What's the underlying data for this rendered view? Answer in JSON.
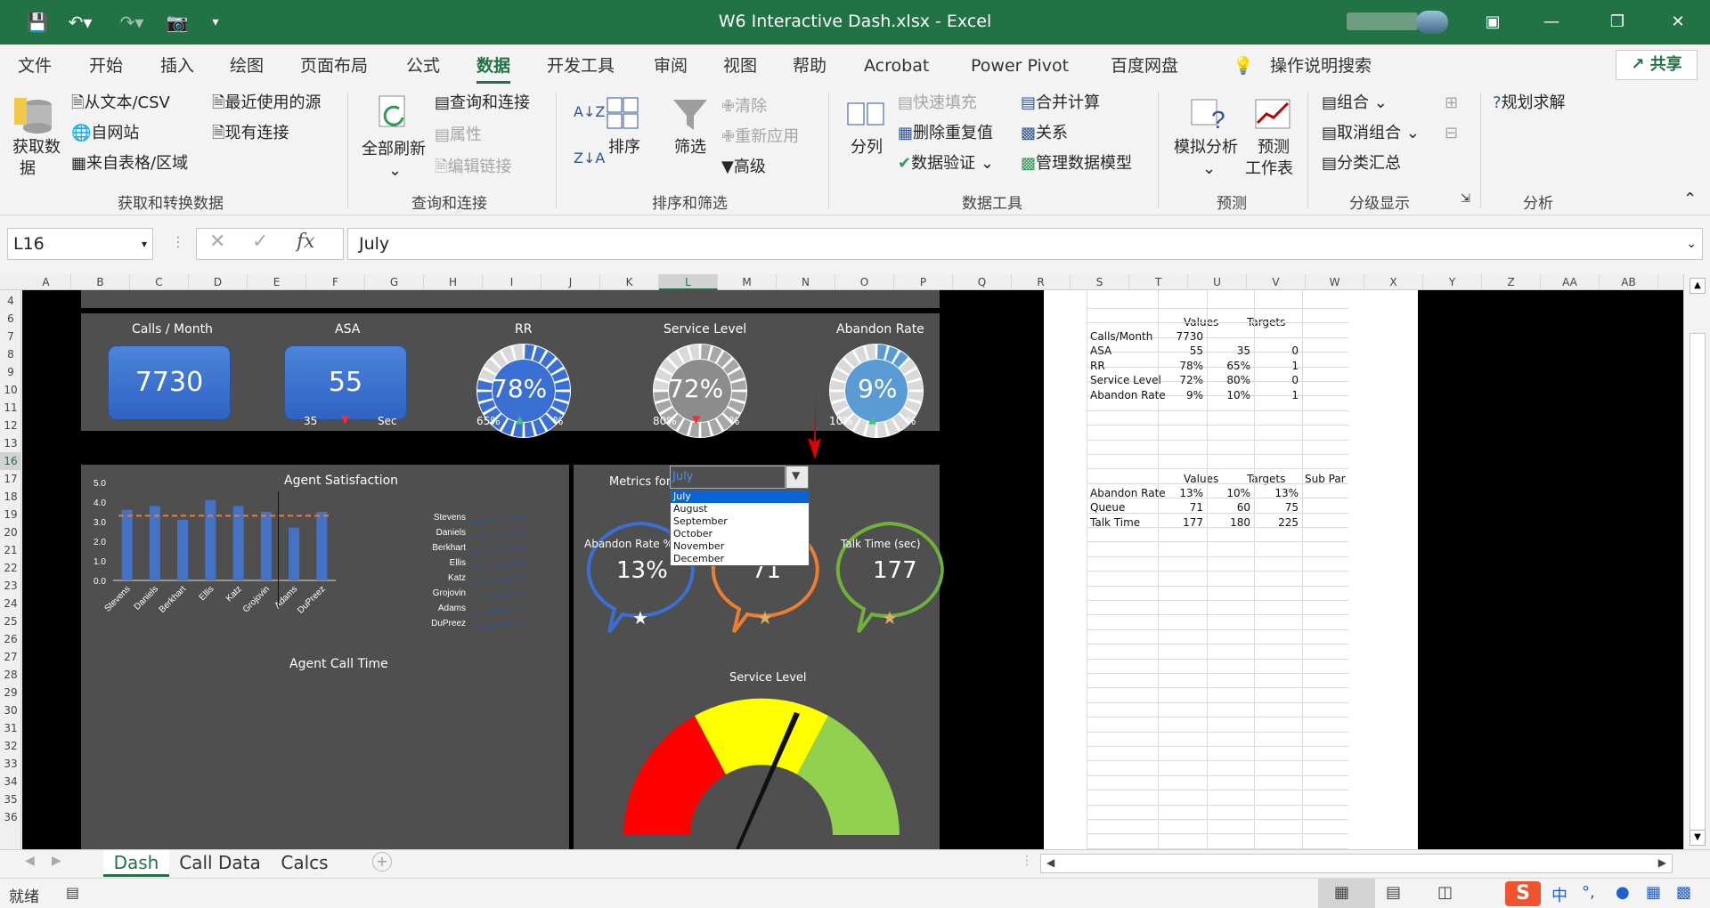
{
  "window": {
    "title": "W6 Interactive Dash.xlsx  -  Excel"
  },
  "tabs": [
    "文件",
    "开始",
    "插入",
    "绘图",
    "页面布局",
    "公式",
    "数据",
    "开发工具",
    "审阅",
    "视图",
    "帮助",
    "Acrobat",
    "Power Pivot",
    "百度网盘",
    "操作说明搜索"
  ],
  "share_label": "共享",
  "ribbon": {
    "get_data": "获取数",
    "get_data2": "据",
    "from_text": "从文本/CSV",
    "from_web": "自网站",
    "from_table": "来自表格/区域",
    "recent_sources": "最近使用的源",
    "existing_conn": "现有连接",
    "group1": "获取和转换数据",
    "refresh_all": "全部刷新",
    "queries_conn": "查询和连接",
    "properties": "属性",
    "edit_links": "编辑链接",
    "group2": "查询和连接",
    "sort": "排序",
    "filter": "筛选",
    "clear": "清除",
    "reapply": "重新应用",
    "advanced": "高级",
    "group3": "排序和筛选",
    "split": "分列",
    "flash_fill": "快速填充",
    "remove_dup": "删除重复值",
    "validation": "数据验证",
    "consolidate": "合并计算",
    "relations": "关系",
    "data_model": "管理数据模型",
    "group4": "数据工具",
    "whatif": "模拟分析",
    "forecast": "预测",
    "forecast2": "工作表",
    "group5": "预测",
    "grp": "组合",
    "ungrp": "取消组合",
    "subtotal": "分类汇总",
    "group6": "分级显示",
    "solver": "规划求解",
    "group7": "分析"
  },
  "formula_bar": {
    "name_box": "L16",
    "value": "July"
  },
  "columns": [
    "A",
    "B",
    "C",
    "D",
    "E",
    "F",
    "G",
    "H",
    "I",
    "J",
    "K",
    "L",
    "M",
    "N",
    "O",
    "P",
    "Q",
    "R",
    "S",
    "T",
    "U",
    "V",
    "W",
    "X",
    "Y",
    "Z",
    "AA",
    "AB"
  ],
  "rows": [
    "4",
    "6",
    "7",
    "8",
    "9",
    "10",
    "11",
    "12",
    "13",
    "16",
    "17",
    "18",
    "19",
    "20",
    "21",
    "22",
    "23",
    "24",
    "25",
    "26",
    "27",
    "28",
    "29",
    "30",
    "31",
    "32",
    "33",
    "34",
    "35",
    "36"
  ],
  "dash": {
    "calls_title": "Calls / Month",
    "calls_value": "7730",
    "asa_title": "ASA",
    "asa_value": "55",
    "asa_target": "35",
    "asa_unit": "Sec",
    "rr_title": "RR",
    "rr_value": "78%",
    "rr_target": "65%",
    "rr_unit": "%",
    "sl_title": "Service Level",
    "sl_value": "72%",
    "sl_target": "80%",
    "sl_unit": "%",
    "ar_title": "Abandon Rate",
    "ar_value": "9%",
    "ar_target": "10%",
    "ar_unit": "%",
    "agent_sat_title": "Agent Satisfaction",
    "agent_call_time": "Agent Call Time",
    "metrics_for": "Metrics for",
    "selected_month": "July",
    "months": [
      "July",
      "August",
      "September",
      "October",
      "November",
      "December"
    ],
    "bubble1_label": "Abandon Rate %",
    "bubble1_value": "13%",
    "bubble2_value": "71",
    "bubble3_label": "Talk Time (sec)",
    "bubble3_value": "177",
    "service_level_title": "Service Level",
    "colors": {
      "green": "#217346",
      "blue": "#3f6fd0",
      "red": "#ff0000",
      "yellow": "#ffff00",
      "lime": "#92d050",
      "orange": "#ed7d31"
    }
  },
  "chart_data": {
    "type": "bar",
    "title": "Agent Satisfaction",
    "categories": [
      "Stevens",
      "Daniels",
      "Berkhart",
      "Ellis",
      "Katz",
      "Grojovin",
      "Adams",
      "DuPreez"
    ],
    "values": [
      3.6,
      3.8,
      3.1,
      4.1,
      3.8,
      3.5,
      2.7,
      3.5
    ],
    "target": 3.3,
    "ylim": [
      0,
      5
    ],
    "yticks": [
      "5.0",
      "4.0",
      "3.0",
      "2.0",
      "1.0",
      "0.0"
    ]
  },
  "calcs": {
    "table1_headers": [
      "Values",
      "Targets"
    ],
    "table1": [
      [
        "Calls/Month",
        "7730",
        "",
        ""
      ],
      [
        "ASA",
        "55",
        "35",
        "0"
      ],
      [
        "RR",
        "78%",
        "65%",
        "1"
      ],
      [
        "Service Level",
        "72%",
        "80%",
        "0"
      ],
      [
        "Abandon Rate",
        "9%",
        "10%",
        "1"
      ]
    ],
    "table2_headers": [
      "Values",
      "Targets",
      "Sub Par"
    ],
    "table2": [
      [
        "Abandon Rate",
        "13%",
        "10%",
        "13%"
      ],
      [
        "Queue",
        "71",
        "60",
        "75"
      ],
      [
        "Talk Time",
        "177",
        "180",
        "225"
      ]
    ]
  },
  "sheet_tabs": [
    "Dash",
    "Call Data",
    "Calcs"
  ],
  "status": {
    "ready": "就绪"
  }
}
